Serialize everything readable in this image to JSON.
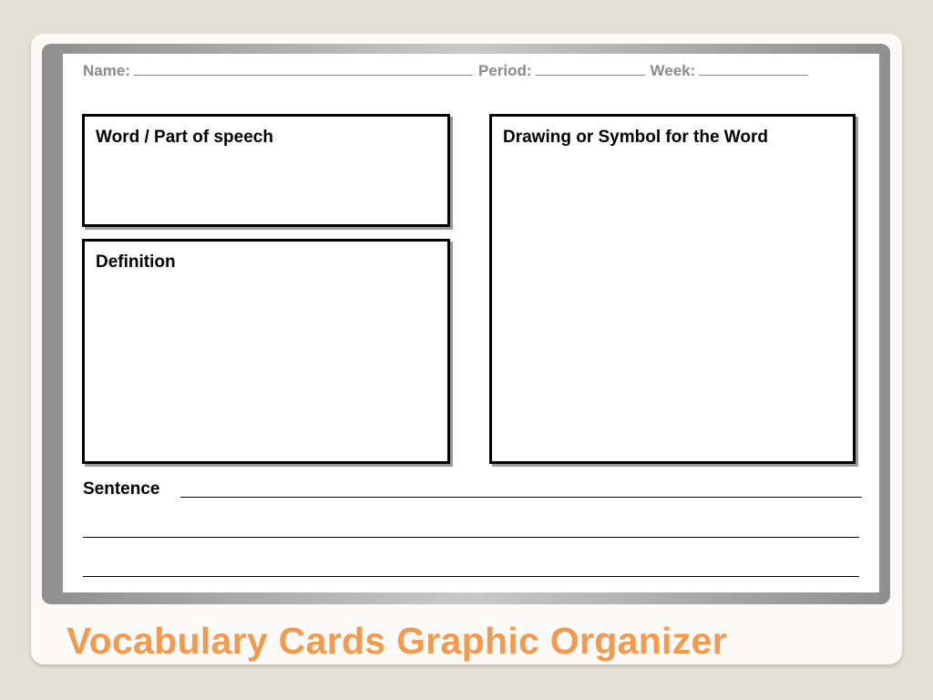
{
  "header": {
    "name_label": "Name:",
    "period_label": "Period:",
    "week_label": "Week:"
  },
  "boxes": {
    "word_label": "Word / Part of speech",
    "definition_label": "Definition",
    "drawing_label": "Drawing or Symbol for the Word"
  },
  "sentence_label": "Sentence",
  "slide_title": "Vocabulary Cards Graphic Organizer",
  "colors": {
    "background": "#e5e0d5",
    "title": "#f39a4e",
    "header_text": "#8a8a8a"
  }
}
